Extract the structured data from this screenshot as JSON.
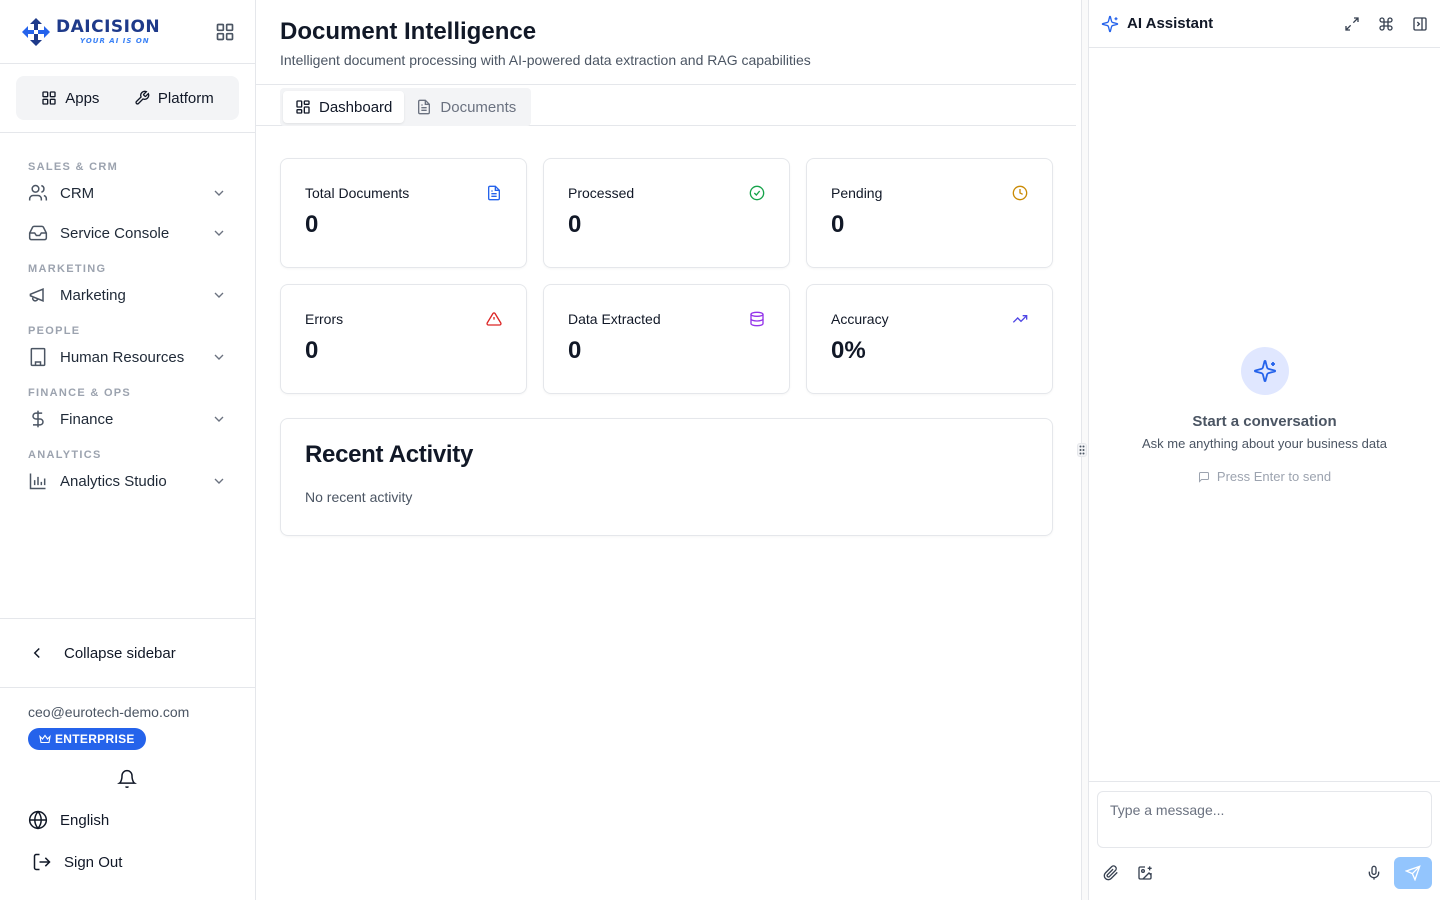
{
  "brand": {
    "name": "DAICISION",
    "tagline": "YOUR AI IS ON",
    "accent": "#2563eb"
  },
  "switcher": {
    "apps_label": "Apps",
    "platform_label": "Platform"
  },
  "nav": {
    "sections": [
      {
        "title": "SALES & CRM",
        "items": [
          {
            "label": "CRM",
            "icon": "users-icon"
          },
          {
            "label": "Service Console",
            "icon": "inbox-icon"
          }
        ]
      },
      {
        "title": "MARKETING",
        "items": [
          {
            "label": "Marketing",
            "icon": "megaphone-icon"
          }
        ]
      },
      {
        "title": "PEOPLE",
        "items": [
          {
            "label": "Human Resources",
            "icon": "building-icon"
          }
        ]
      },
      {
        "title": "FINANCE & OPS",
        "items": [
          {
            "label": "Finance",
            "icon": "dollar-icon"
          }
        ]
      },
      {
        "title": "ANALYTICS",
        "items": [
          {
            "label": "Analytics Studio",
            "icon": "bar-chart-icon"
          }
        ]
      }
    ]
  },
  "sidebar_footer": {
    "collapse_label": "Collapse sidebar",
    "email": "ceo@eurotech-demo.com",
    "plan_badge": "ENTERPRISE",
    "language": "English",
    "sign_out": "Sign Out"
  },
  "page": {
    "title": "Document Intelligence",
    "subtitle": "Intelligent document processing with AI-powered data extraction and RAG capabilities",
    "tabs": [
      {
        "label": "Dashboard",
        "active": true
      },
      {
        "label": "Documents",
        "active": false
      }
    ]
  },
  "stats": [
    {
      "label": "Total Documents",
      "value": "0",
      "icon": "document-icon",
      "color": "#2563eb"
    },
    {
      "label": "Processed",
      "value": "0",
      "icon": "check-circle-icon",
      "color": "#16a34a"
    },
    {
      "label": "Pending",
      "value": "0",
      "icon": "clock-icon",
      "color": "#ca8a04"
    },
    {
      "label": "Errors",
      "value": "0",
      "icon": "alert-triangle-icon",
      "color": "#dc2626"
    },
    {
      "label": "Data Extracted",
      "value": "0",
      "icon": "database-icon",
      "color": "#9333ea"
    },
    {
      "label": "Accuracy",
      "value": "0%",
      "icon": "trending-up-icon",
      "color": "#4f46e5"
    }
  ],
  "activity": {
    "title": "Recent Activity",
    "empty": "No recent activity"
  },
  "assistant": {
    "title": "AI Assistant",
    "empty_title": "Start a conversation",
    "empty_sub": "Ask me anything about your business data",
    "hint": "Press Enter to send",
    "placeholder": "Type a message..."
  }
}
